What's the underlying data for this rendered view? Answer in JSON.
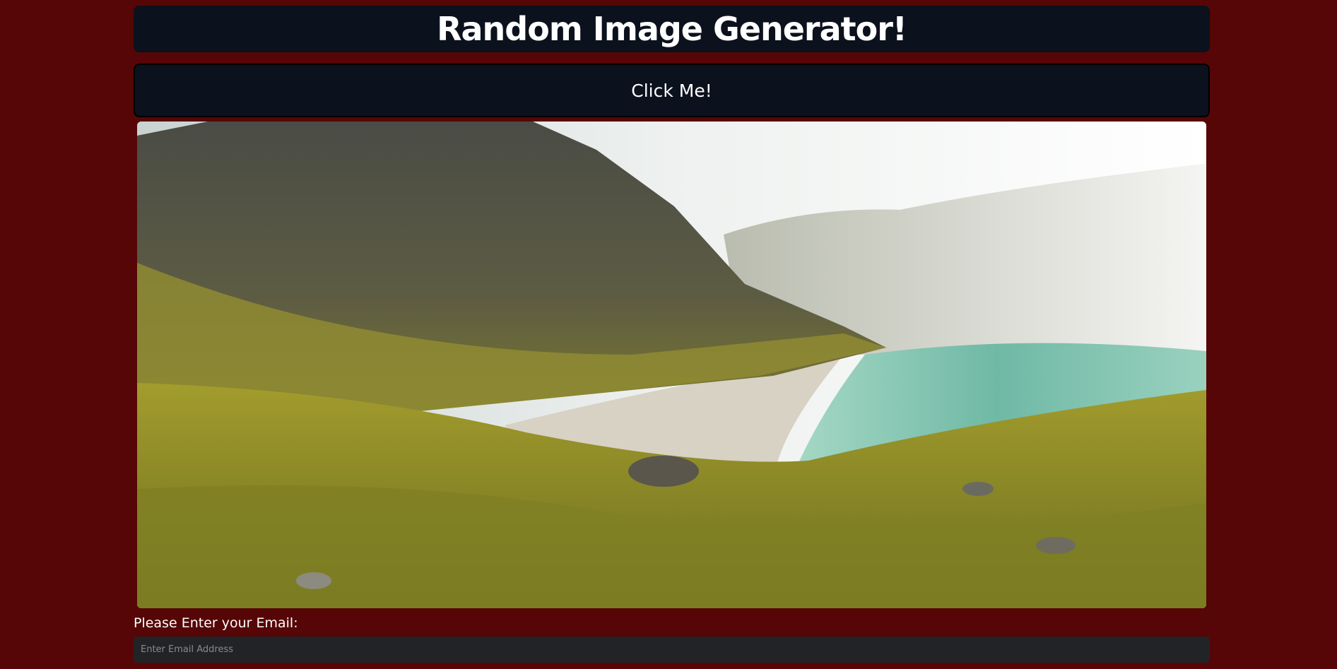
{
  "header": {
    "title": "Random Image Generator!"
  },
  "button": {
    "label": "Click Me!"
  },
  "image": {
    "description_icon": "landscape-photo"
  },
  "form": {
    "email_label": "Please Enter your Email:",
    "email_placeholder": "Enter Email Address",
    "email_value": ""
  },
  "colors": {
    "background": "#560606",
    "panel": "#0b111d",
    "input": "#222327",
    "text": "#ffffff"
  }
}
